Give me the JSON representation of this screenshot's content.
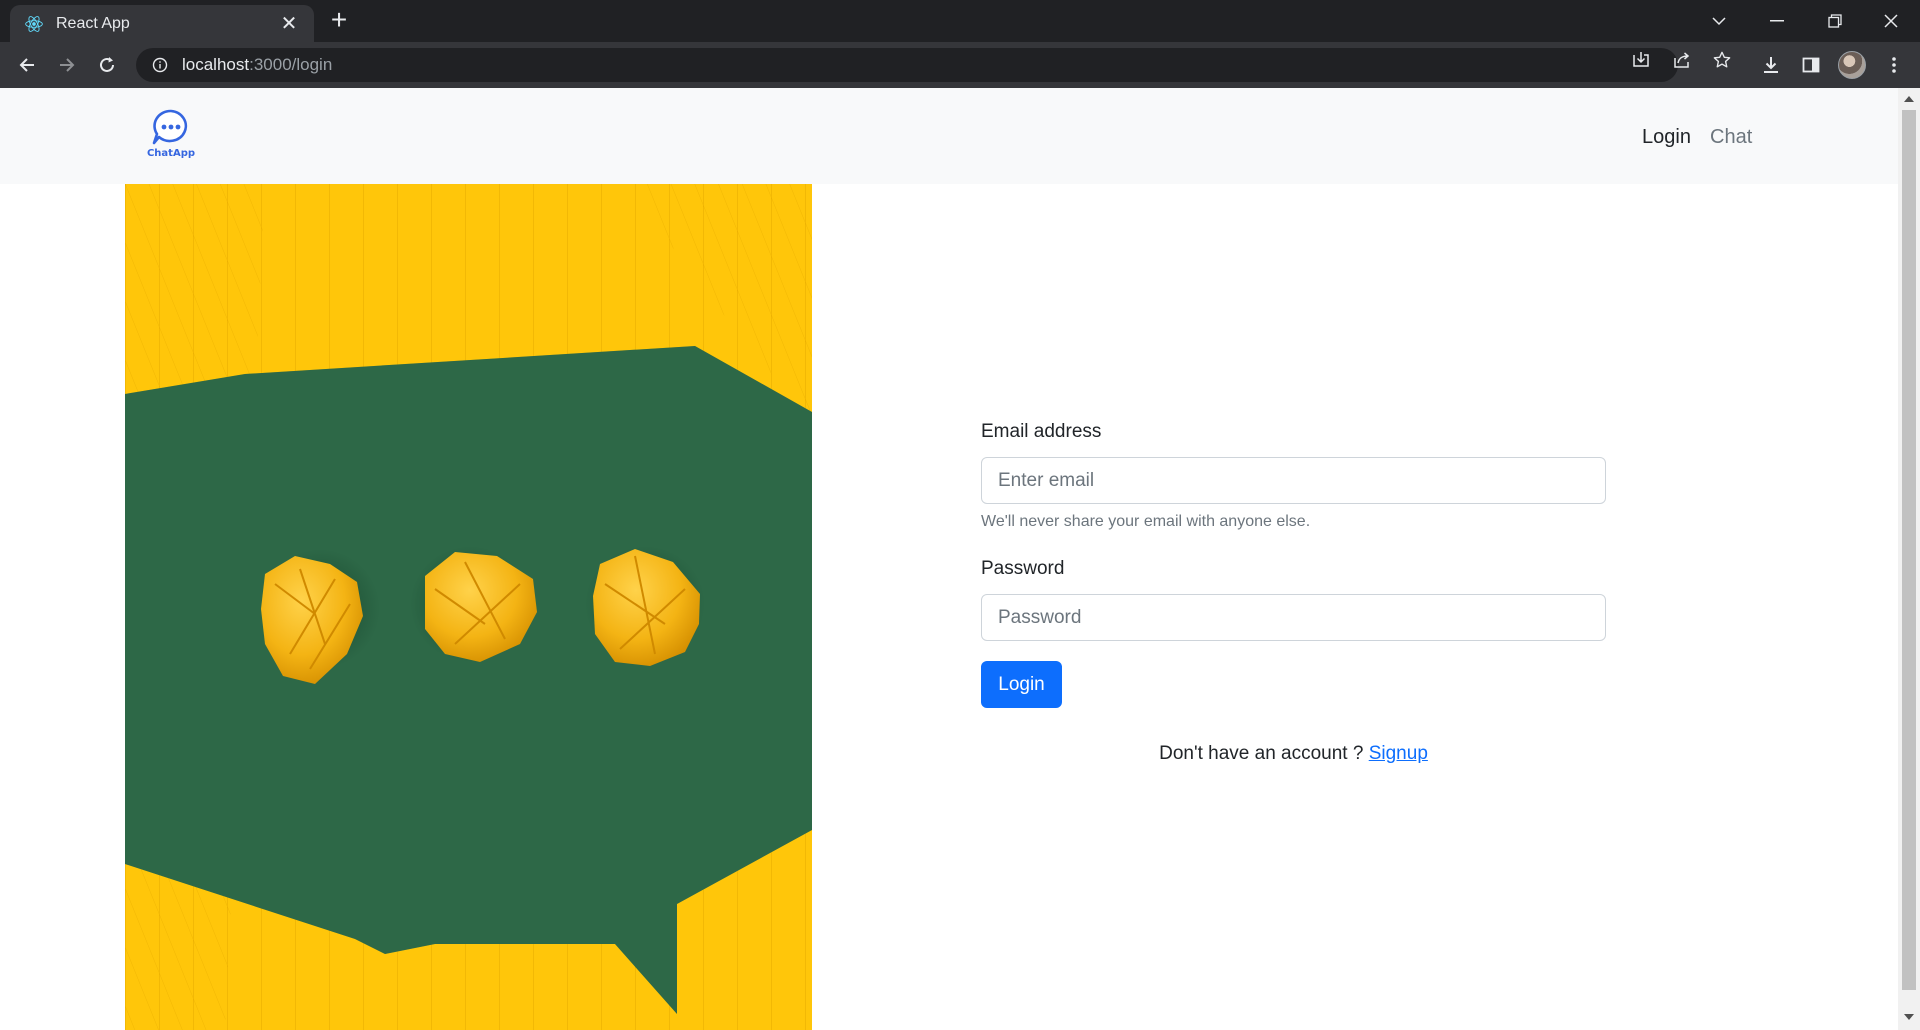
{
  "browser": {
    "tab_title": "React App",
    "url_host": "localhost",
    "url_path": ":3000/login"
  },
  "navbar": {
    "brand_text": "ChatApp",
    "links": [
      {
        "label": "Login"
      },
      {
        "label": "Chat"
      }
    ]
  },
  "form": {
    "email_label": "Email address",
    "email_placeholder": "Enter email",
    "email_help": "We'll never share your email with anyone else.",
    "password_label": "Password",
    "password_placeholder": "Password",
    "submit_label": "Login",
    "signup_prompt": "Don't have an account ? ",
    "signup_link": "Signup"
  },
  "colors": {
    "primary": "#0d6efd",
    "navbar_bg": "#f8f9fa",
    "hero_green": "#2f6b4a",
    "hero_yellow": "#ffc60a"
  }
}
